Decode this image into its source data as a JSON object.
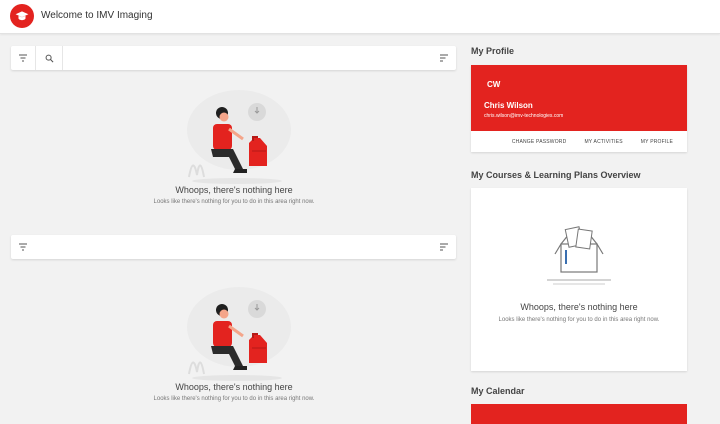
{
  "header": {
    "title": "Welcome to IMV Imaging",
    "logo_icon": "graduation-cap-icon"
  },
  "main": {
    "widget1": {
      "toolbar_icons": [
        "filter-icon",
        "search-icon",
        "sort-icon"
      ],
      "search_placeholder": "",
      "empty_title": "Whoops, there's nothing here",
      "empty_sub": "Looks like there's nothing for you to do in this area right now."
    },
    "widget2": {
      "toolbar_icons": [
        "filter-icon",
        "sort-icon"
      ],
      "empty_title": "Whoops, there's nothing here",
      "empty_sub": "Looks like there's nothing for you to do in this area right now."
    }
  },
  "sidebar": {
    "profile": {
      "section_title": "My Profile",
      "initials": "CW",
      "name": "Chris Wilson",
      "email": "chris.wilson@imv-technologies.com",
      "links": [
        "CHANGE PASSWORD",
        "MY ACTIVITIES",
        "MY PROFILE"
      ]
    },
    "courses": {
      "section_title": "My Courses & Learning Plans Overview",
      "empty_title": "Whoops, there's nothing here",
      "empty_sub": "Looks like there's nothing for you to do in this area right now."
    },
    "calendar": {
      "section_title": "My Calendar"
    }
  },
  "colors": {
    "brand": "#e3231f",
    "background": "#f2f2f2"
  }
}
